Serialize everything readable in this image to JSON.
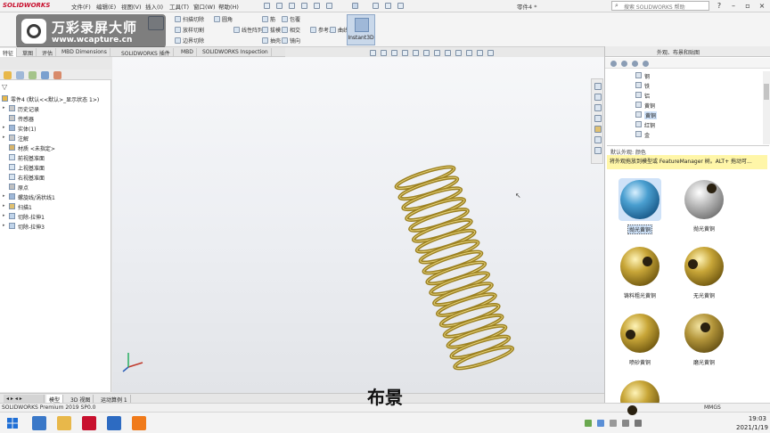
{
  "titlebar": {
    "logo": "SOLIDWORKS",
    "menus": [
      "文件(F)",
      "编辑(E)",
      "视图(V)",
      "插入(I)",
      "工具(T)",
      "窗口(W)",
      "帮助(H)"
    ],
    "doc_title": "零件4 *",
    "search_placeholder": "搜索 SOLIDWORKS 帮助"
  },
  "watermark": {
    "title": "万彩录屏大师",
    "url": "www.wcapture.cn"
  },
  "ribbon": {
    "small_items": [
      "扫描切除",
      "放样切割",
      "边界切除",
      "圆角",
      "线性阵列",
      "筋",
      "拔模",
      "抽壳",
      "包覆",
      "相交",
      "镜向",
      "参考...",
      "曲线"
    ],
    "instant3d_label": "Instant3D"
  },
  "command_tabs": [
    "特征",
    "草图",
    "评估",
    "MBD Dimensions",
    "SOLIDWORKS 插件",
    "MBD",
    "SOLIDWORKS Inspection"
  ],
  "feature_tree": [
    {
      "label": "零件4 (默认<<默认>_显示状态 1>)",
      "indent": 0,
      "arrow": ""
    },
    {
      "label": "历史记录",
      "indent": 1,
      "arrow": "▸"
    },
    {
      "label": "传感器",
      "indent": 1,
      "arrow": ""
    },
    {
      "label": "实体(1)",
      "indent": 1,
      "arrow": "▸"
    },
    {
      "label": "注解",
      "indent": 1,
      "arrow": "▸"
    },
    {
      "label": "材质 <未指定>",
      "indent": 1,
      "arrow": ""
    },
    {
      "label": "前视基准面",
      "indent": 1,
      "arrow": ""
    },
    {
      "label": "上视基准面",
      "indent": 1,
      "arrow": ""
    },
    {
      "label": "右视基准面",
      "indent": 1,
      "arrow": ""
    },
    {
      "label": "原点",
      "indent": 1,
      "arrow": ""
    },
    {
      "label": "螺旋线/涡状线1",
      "indent": 1,
      "arrow": "▸"
    },
    {
      "label": "扫描1",
      "indent": 1,
      "arrow": "▸"
    },
    {
      "label": "切除-拉伸1",
      "indent": 1,
      "arrow": "▸"
    },
    {
      "label": "切除-拉伸3",
      "indent": 1,
      "arrow": "▸"
    }
  ],
  "task_pane": {
    "title": "外观、布景和贴图",
    "materials": [
      {
        "label": "钢",
        "selected": false
      },
      {
        "label": "铁",
        "selected": false
      },
      {
        "label": "铝",
        "selected": false
      },
      {
        "label": "黄铜",
        "selected": false
      },
      {
        "label": "黄铜",
        "selected": true
      },
      {
        "label": "红铜",
        "selected": false
      },
      {
        "label": "金",
        "selected": false
      }
    ],
    "info_label": "默认外观: 颜色",
    "info_text": "将外观拖放到模型或 FeatureManager 树。ALT+ 拖动可...",
    "swatches": [
      {
        "label": "抛光黄铜",
        "style": "blue",
        "selected": true
      },
      {
        "label": "抛光黄铜",
        "style": "silver",
        "selected": false
      },
      {
        "label": "铸料粗光黄铜",
        "style": "gold",
        "selected": false
      },
      {
        "label": "无光黄铜",
        "style": "gold",
        "selected": false
      },
      {
        "label": "喷砂黄铜",
        "style": "gold",
        "selected": false
      },
      {
        "label": "磨光黄铜",
        "style": "gold2",
        "selected": false
      },
      {
        "label": "",
        "style": "gold",
        "selected": false
      }
    ]
  },
  "bottom_tabs": [
    "模型",
    "3D 视图",
    "运动算例 1"
  ],
  "statusbar": {
    "left": "SOLIDWORKS Premium 2019 SP0.0",
    "units": "MMGS"
  },
  "subtitle": "布景",
  "tray": {
    "time": "19:03",
    "date": "2021/1/19"
  },
  "colors": {
    "spring": "#9c8121",
    "accent": "#c8102e"
  }
}
